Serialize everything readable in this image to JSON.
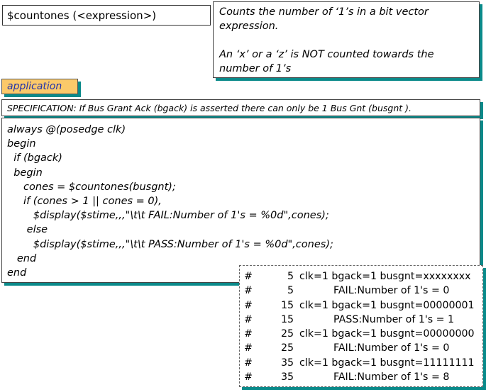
{
  "syntax": "$countones (<expression>)",
  "description": {
    "line1": "Counts the number of ‘1’s in a bit vector expression.",
    "line2": "An ‘x’ or a ‘z’ is NOT counted towards the number of 1’s"
  },
  "label": "application",
  "specification": "SPECIFICATION: If Bus Grant Ack (bgack) is asserted there can only be 1 Bus Gnt (busgnt ).",
  "code": [
    "always @(posedge clk)",
    "begin",
    "  if (bgack)",
    "  begin",
    "     cones = $countones(busgnt);",
    "     if (cones > 1 || cones = 0),",
    "        $display($stime,,,\"\\t\\t FAIL:Number of 1's = %0d\",cones);",
    "      else",
    "        $display($stime,,,\"\\t\\t PASS:Number of 1's = %0d\",cones);",
    "   end",
    "end"
  ],
  "output": [
    {
      "hash": "#",
      "time": "5",
      "text": "clk=1 bgack=1 busgnt=xxxxxxxx",
      "msg": false
    },
    {
      "hash": "#",
      "time": "5",
      "text": "FAIL:Number of 1's = 0",
      "msg": true
    },
    {
      "hash": "#",
      "time": "15",
      "text": "clk=1 bgack=1 busgnt=00000001",
      "msg": false
    },
    {
      "hash": "#",
      "time": "15",
      "text": "PASS:Number of 1's = 1",
      "msg": true
    },
    {
      "hash": "#",
      "time": "25",
      "text": "clk=1 bgack=1 busgnt=00000000",
      "msg": false
    },
    {
      "hash": "#",
      "time": "25",
      "text": "FAIL:Number of 1's = 0",
      "msg": true
    },
    {
      "hash": "#",
      "time": "35",
      "text": "clk=1 bgack=1 busgnt=11111111",
      "msg": false
    },
    {
      "hash": "#",
      "time": "35",
      "text": "FAIL:Number of 1's = 8",
      "msg": true
    }
  ]
}
